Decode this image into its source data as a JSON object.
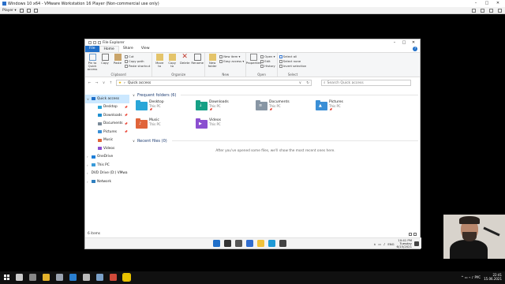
{
  "vm_window": {
    "title": "Windows 10 x64 - VMware Workstation 16 Player (Non-commercial use only)",
    "player_menu": "Player ▾",
    "controls": [
      "–",
      "□",
      "✕"
    ]
  },
  "explorer": {
    "title": "File Explorer",
    "controls": [
      "–",
      "□",
      "✕"
    ],
    "tabs": [
      {
        "label": "File",
        "kind": "file"
      },
      {
        "label": "Home",
        "kind": "active"
      },
      {
        "label": "Share",
        "kind": "normal"
      },
      {
        "label": "View",
        "kind": "normal"
      }
    ],
    "help": "?",
    "ribbon": {
      "clipboard": {
        "name": "Clipboard",
        "pin": "Pin to Quick access",
        "copy": "Copy",
        "paste": "Paste",
        "cut": "Cut",
        "copy_path": "Copy path",
        "paste_shortcut": "Paste shortcut"
      },
      "organize": {
        "name": "Organize",
        "move_to": "Move to",
        "copy_to": "Copy to",
        "delete": "Delete",
        "rename": "Rename"
      },
      "new": {
        "name": "New",
        "new_folder": "New folder",
        "new_item": "New item ▾",
        "easy_access": "Easy access ▾"
      },
      "open": {
        "name": "Open",
        "properties": "Properties",
        "open": "Open ▾",
        "edit": "Edit",
        "history": "History"
      },
      "select": {
        "name": "Select",
        "select_all": "Select all",
        "select_none": "Select none",
        "invert_selection": "Invert selection"
      }
    },
    "address": {
      "back": "←",
      "forward": "→",
      "dropdown": "∨",
      "up": "↑",
      "path": "Quick access",
      "crumb_sep": "›",
      "refresh": "↻",
      "search_placeholder": "Search Quick access"
    },
    "sidebar": [
      {
        "label": "Quick access",
        "chev": "∨",
        "color": "#1f6fc9",
        "indent": 0,
        "selected": true,
        "pin": ""
      },
      {
        "label": "Desktop",
        "chev": "",
        "color": "#2aa6d8",
        "indent": 8,
        "selected": false,
        "pin": "📌"
      },
      {
        "label": "Downloads",
        "chev": "",
        "color": "#1e8fd1",
        "indent": 8,
        "selected": false,
        "pin": "📌"
      },
      {
        "label": "Documents",
        "chev": "",
        "color": "#7a8a99",
        "indent": 8,
        "selected": false,
        "pin": "📌"
      },
      {
        "label": "Pictures",
        "chev": "",
        "color": "#3a8fd6",
        "indent": 8,
        "selected": false,
        "pin": "📌"
      },
      {
        "label": "Music",
        "chev": "",
        "color": "#e0643a",
        "indent": 8,
        "selected": false,
        "pin": ""
      },
      {
        "label": "Videos",
        "chev": "",
        "color": "#8b4fd0",
        "indent": 8,
        "selected": false,
        "pin": ""
      },
      {
        "label": "OneDrive",
        "chev": "›",
        "color": "#1e7fd8",
        "indent": 0,
        "selected": false,
        "pin": ""
      },
      {
        "label": "This PC",
        "chev": "›",
        "color": "#3a9bd9",
        "indent": 0,
        "selected": false,
        "pin": ""
      },
      {
        "label": "DVD Drive (D:) VMwa",
        "chev": "›",
        "color": "#555555",
        "indent": 0,
        "selected": false,
        "pin": ""
      },
      {
        "label": "Network",
        "chev": "›",
        "color": "#2f7fbf",
        "indent": 0,
        "selected": false,
        "pin": ""
      }
    ],
    "frequent": {
      "header": "Frequent folders (6)",
      "chev": "∨",
      "items": [
        {
          "name": "Desktop",
          "location": "This PC",
          "color": "#2aa6d8",
          "glyph": "",
          "pin": "📌"
        },
        {
          "name": "Downloads",
          "location": "This PC",
          "color": "#16a085",
          "glyph": "↓",
          "pin": "📌"
        },
        {
          "name": "Documents",
          "location": "This PC",
          "color": "#8896a4",
          "glyph": "≡",
          "pin": "📌"
        },
        {
          "name": "Pictures",
          "location": "This PC",
          "color": "#3a8fd6",
          "glyph": "▲",
          "pin": "📌"
        },
        {
          "name": "Music",
          "location": "This PC",
          "color": "#e0643a",
          "glyph": "♪",
          "pin": ""
        },
        {
          "name": "Videos",
          "location": "This PC",
          "color": "#8b4fd0",
          "glyph": "▶",
          "pin": ""
        }
      ]
    },
    "recent": {
      "header": "Recent files (0)",
      "chev": "∨",
      "empty_text": "After you've opened some files, we'll show the most recent ones here."
    },
    "status": "6 items"
  },
  "guest_taskbar": {
    "apps": [
      {
        "name": "start-icon",
        "color": "#1f6fc9"
      },
      {
        "name": "search-icon",
        "color": "#333333"
      },
      {
        "name": "task-view-icon",
        "color": "#555555"
      },
      {
        "name": "widgets-icon",
        "color": "#2f6ccf"
      },
      {
        "name": "file-explorer-icon",
        "color": "#f0c23b"
      },
      {
        "name": "edge-icon",
        "color": "#1f9ad6"
      },
      {
        "name": "store-icon",
        "color": "#444444"
      }
    ],
    "tray_arrow": "∧",
    "lang": "ENG",
    "time": "10:41 PM",
    "day": "Tuesday",
    "date": "6/15/2021"
  },
  "host_taskbar": {
    "apps": [
      {
        "name": "search-icon",
        "color": "#cccccc"
      },
      {
        "name": "task-view-icon",
        "color": "#888888"
      },
      {
        "name": "chrome-icon",
        "color": "#e4b22b"
      },
      {
        "name": "network-icon",
        "color": "#9aa3b0"
      },
      {
        "name": "terminal-icon",
        "color": "#2a7fd0"
      },
      {
        "name": "app-icon",
        "color": "#bbbbbb"
      },
      {
        "name": "app-icon-2",
        "color": "#7aa0c8"
      },
      {
        "name": "screen-icon",
        "color": "#d04a3a"
      },
      {
        "name": "vmware-icon",
        "color": "#e8c200",
        "active": true
      }
    ],
    "tray_text": "^ ▭ ⌁ ♪ РУС",
    "time": "22:41",
    "date": "15.06.2021"
  }
}
